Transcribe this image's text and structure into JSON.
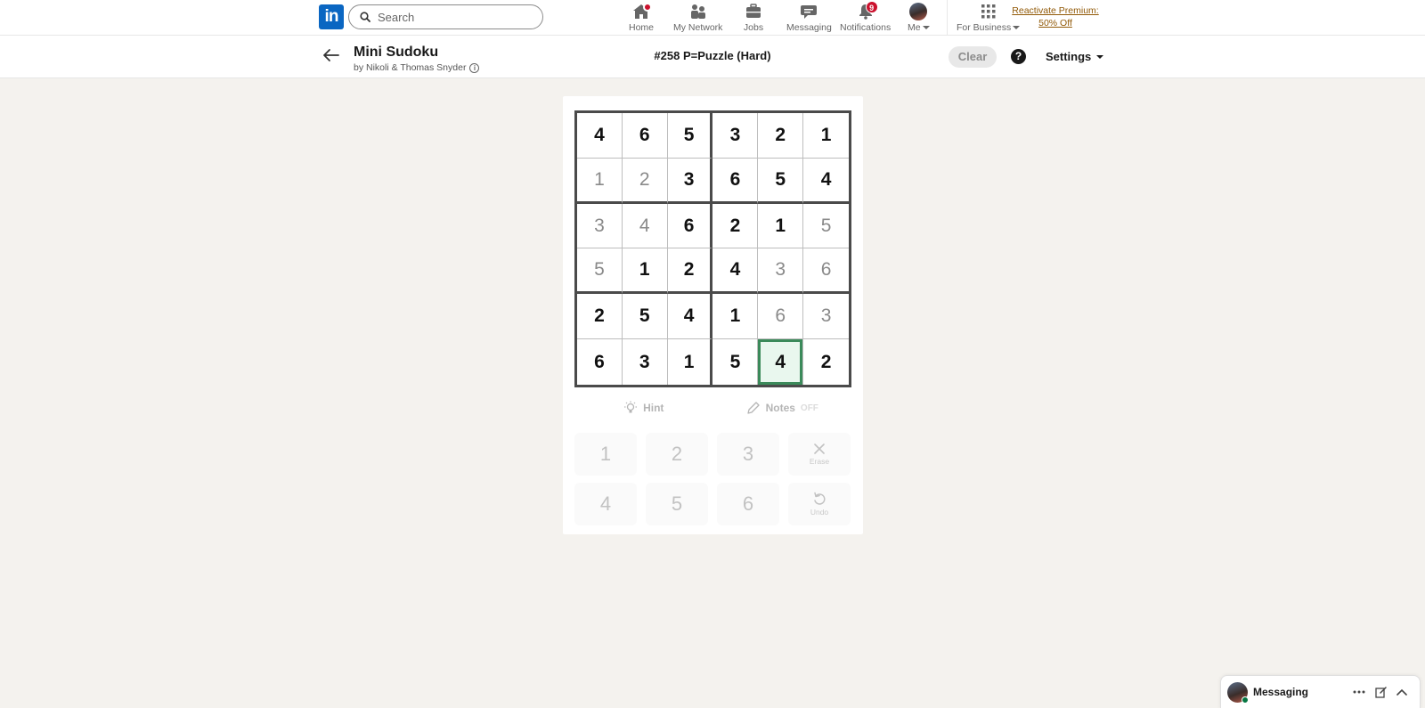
{
  "nav": {
    "logo": "in",
    "search_placeholder": "Search",
    "items": [
      {
        "label": "Home",
        "badge": ""
      },
      {
        "label": "My Network",
        "badge": ""
      },
      {
        "label": "Jobs",
        "badge": ""
      },
      {
        "label": "Messaging",
        "badge": ""
      },
      {
        "label": "Notifications",
        "badge": "9"
      },
      {
        "label": "Me",
        "badge": ""
      },
      {
        "label": "For Business",
        "badge": ""
      }
    ],
    "premium_line1": "Reactivate Premium:",
    "premium_line2": "50% Off"
  },
  "game": {
    "title": "Mini Sudoku",
    "byline": "by Nikoli & Thomas Snyder",
    "puzzle_id": "#258 P=Puzzle (Hard)",
    "clear_label": "Clear",
    "help_label": "?",
    "settings_label": "Settings",
    "grid": [
      [
        {
          "v": "4",
          "t": "given"
        },
        {
          "v": "6",
          "t": "given"
        },
        {
          "v": "5",
          "t": "given"
        },
        {
          "v": "3",
          "t": "given"
        },
        {
          "v": "2",
          "t": "given"
        },
        {
          "v": "1",
          "t": "given"
        }
      ],
      [
        {
          "v": "1",
          "t": "user"
        },
        {
          "v": "2",
          "t": "user"
        },
        {
          "v": "3",
          "t": "given"
        },
        {
          "v": "6",
          "t": "given"
        },
        {
          "v": "5",
          "t": "given"
        },
        {
          "v": "4",
          "t": "given"
        }
      ],
      [
        {
          "v": "3",
          "t": "user"
        },
        {
          "v": "4",
          "t": "user"
        },
        {
          "v": "6",
          "t": "given"
        },
        {
          "v": "2",
          "t": "given"
        },
        {
          "v": "1",
          "t": "given"
        },
        {
          "v": "5",
          "t": "user"
        }
      ],
      [
        {
          "v": "5",
          "t": "user"
        },
        {
          "v": "1",
          "t": "given"
        },
        {
          "v": "2",
          "t": "given"
        },
        {
          "v": "4",
          "t": "given"
        },
        {
          "v": "3",
          "t": "user"
        },
        {
          "v": "6",
          "t": "user"
        }
      ],
      [
        {
          "v": "2",
          "t": "given"
        },
        {
          "v": "5",
          "t": "given"
        },
        {
          "v": "4",
          "t": "given"
        },
        {
          "v": "1",
          "t": "given"
        },
        {
          "v": "6",
          "t": "user"
        },
        {
          "v": "3",
          "t": "user"
        }
      ],
      [
        {
          "v": "6",
          "t": "given"
        },
        {
          "v": "3",
          "t": "given"
        },
        {
          "v": "1",
          "t": "given"
        },
        {
          "v": "5",
          "t": "given"
        },
        {
          "v": "4",
          "t": "given",
          "selected": true
        },
        {
          "v": "2",
          "t": "given"
        }
      ]
    ],
    "hint_label": "Hint",
    "notes_label": "Notes",
    "notes_state": "OFF",
    "keys": [
      "1",
      "2",
      "3",
      "4",
      "5",
      "6"
    ],
    "erase_label": "Erase",
    "undo_label": "Undo"
  },
  "messaging": {
    "title": "Messaging"
  },
  "colors": {
    "brand": "#0a66c2",
    "selected_border": "#3b8a5a",
    "premium": "#915907",
    "badge": "#cb112d"
  }
}
